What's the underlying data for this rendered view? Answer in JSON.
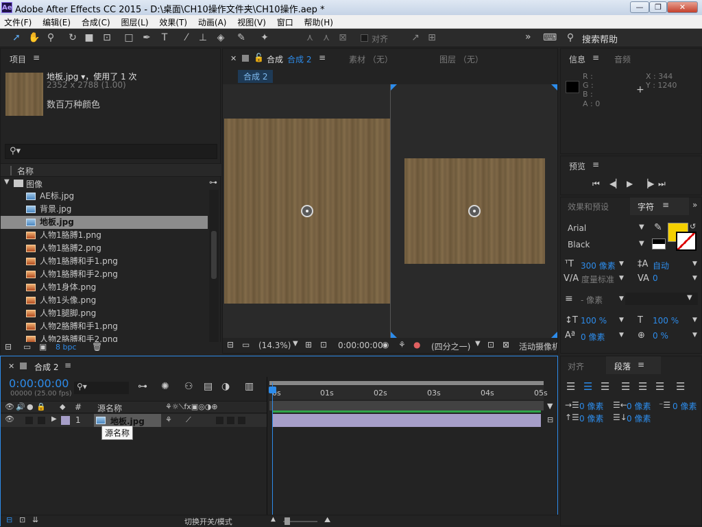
{
  "window": {
    "title": "Adobe After Effects CC 2015 - D:\\桌面\\CH10操作文件夹\\CH10操作.aep *",
    "logo": "Ae",
    "min": "—",
    "max": "❐",
    "close": "✕"
  },
  "menu": [
    "文件(F)",
    "编辑(E)",
    "合成(C)",
    "图层(L)",
    "效果(T)",
    "动画(A)",
    "视图(V)",
    "窗口",
    "帮助(H)"
  ],
  "toolbar": {
    "align_label": "对齐",
    "search_label": "搜索帮助",
    "more": "»"
  },
  "project": {
    "tab": "项目",
    "selected_name": "地板.jpg ▾，使用了 1 次",
    "selected_dims": "2352 x 2788 (1.00)",
    "selected_color": "数百万种颜色",
    "search_placeholder": "",
    "col_name": "名称",
    "folder": "图像",
    "files": [
      {
        "name": "AE标.jpg",
        "type": "jpg"
      },
      {
        "name": "背景.jpg",
        "type": "jpg"
      },
      {
        "name": "地板.jpg",
        "type": "jpg",
        "selected": true
      },
      {
        "name": "人物1胳膊1.png",
        "type": "png"
      },
      {
        "name": "人物1胳膊2.png",
        "type": "png"
      },
      {
        "name": "人物1胳膊和手1.png",
        "type": "png"
      },
      {
        "name": "人物1胳膊和手2.png",
        "type": "png"
      },
      {
        "name": "人物1身体.png",
        "type": "png"
      },
      {
        "name": "人物1头像.png",
        "type": "png"
      },
      {
        "name": "人物1腿脚.png",
        "type": "png"
      },
      {
        "name": "人物2胳膊和手1.png",
        "type": "png"
      },
      {
        "name": "人物2胳膊和手2.png",
        "type": "png"
      }
    ],
    "bpc": "8 bpc"
  },
  "viewer": {
    "tab_comp": "合成",
    "tab_comp_name": "合成 2",
    "tab_footage": "素材 （无）",
    "tab_layer": "图层 （无）",
    "breadcrumb": "合成 2",
    "zoom": "(14.3%)",
    "timecode": "0:00:00:00",
    "resolution": "(四分之一)",
    "camera": "活动摄像机"
  },
  "info": {
    "tab": "信息",
    "tab2": "音频",
    "r": "R :",
    "g": "G :",
    "b": "B :",
    "a": "A : 0",
    "x": "X : 344",
    "y": "Y : 1240"
  },
  "preview": {
    "tab": "预览",
    "controls": [
      "first",
      "prev",
      "play",
      "next",
      "last"
    ]
  },
  "character": {
    "tab_effects": "效果和预设",
    "tab_char": "字符",
    "font": "Arial",
    "style": "Black",
    "size": "300 像素",
    "leading": "自动",
    "kerning": "度量标准",
    "tracking": "0",
    "stroke_width": "- 像素",
    "vscale": "100 %",
    "hscale": "100 %",
    "baseline": "0 像素",
    "tsume": "0 %",
    "fill_color": "#f5d000"
  },
  "paragraph": {
    "tab_align": "对齐",
    "tab_para": "段落",
    "indent_left": "0 像素",
    "indent_first": "0 像素",
    "indent_right": "0 像素",
    "space_before": "0 像素",
    "space_after": "0 像素"
  },
  "timeline": {
    "tab": "合成 2",
    "timecode": "0:00:00:00",
    "fps": "00000 (25.00 fps)",
    "col_num": "#",
    "col_source": "源名称",
    "ruler": [
      "0s",
      "01s",
      "02s",
      "03s",
      "04s",
      "05s"
    ],
    "layer_num": "1",
    "layer_name": "地板.jpg",
    "tooltip": "源名称",
    "toggle_label": "切换开关/模式"
  }
}
